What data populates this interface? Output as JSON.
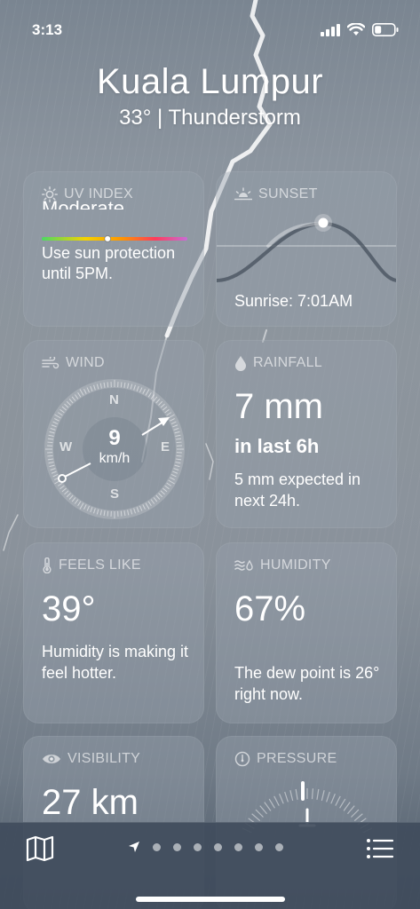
{
  "status_bar": {
    "time": "3:13",
    "icons": [
      "signal-icon",
      "wifi-icon",
      "battery-icon"
    ]
  },
  "header": {
    "city": "Kuala Lumpur",
    "summary": "33° | Thunderstorm"
  },
  "uv_index": {
    "title": "UV INDEX",
    "level": "Moderate",
    "level_fraction": 0.45,
    "description": "Use sun protection until 5PM."
  },
  "sunset": {
    "title": "SUNSET",
    "sunrise": "Sunrise: 7:01AM"
  },
  "wind": {
    "title": "WIND",
    "speed": "9",
    "unit": "km/h",
    "compass": {
      "n": "N",
      "e": "E",
      "s": "S",
      "w": "W"
    }
  },
  "rainfall": {
    "title": "RAINFALL",
    "amount": "7 mm",
    "period": "in last 6h",
    "forecast": "5 mm expected in next 24h."
  },
  "feels_like": {
    "title": "FEELS LIKE",
    "value": "39°",
    "description": "Humidity is making it feel hotter."
  },
  "humidity": {
    "title": "HUMIDITY",
    "value": "67%",
    "description": "The dew point is 26° right now."
  },
  "visibility": {
    "title": "VISIBILITY",
    "value": "27 km"
  },
  "pressure": {
    "title": "PRESSURE"
  },
  "bottom_bar": {
    "page_count": 7,
    "current": "location"
  },
  "colors": {
    "card_bg": "#96a0ac",
    "bottom_bar": "#404c5c",
    "sun_dot": "#ffffff"
  }
}
